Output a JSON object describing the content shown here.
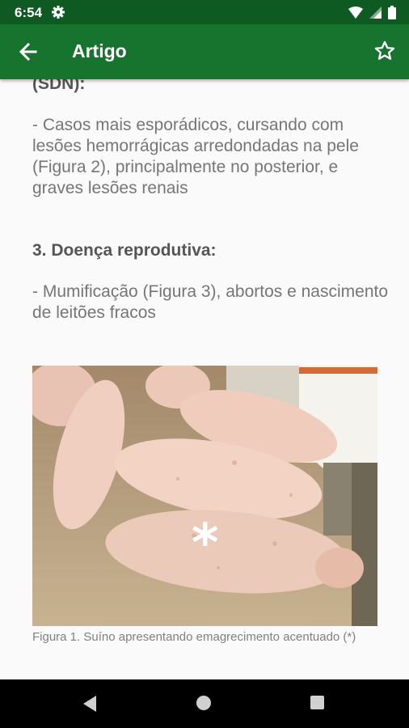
{
  "status_bar": {
    "time": "6:54"
  },
  "app_bar": {
    "title": "Artigo"
  },
  "article": {
    "cut_heading": "(SDN):",
    "paragraph_1": "- Casos mais esporádicos, cursando com lesões hemorrágicas arredondadas na pele (Figura 2), principalmente no posterior, e graves lesões renais",
    "section_3_title": "3. Doença reprodutiva:",
    "paragraph_2": "- Mumificação (Figura 3), abortos e nascimento de leitões fracos",
    "figure_marker": "*",
    "figure_caption": "Figura 1. Suíno apresentando emagrecimento acentuado (*)"
  }
}
